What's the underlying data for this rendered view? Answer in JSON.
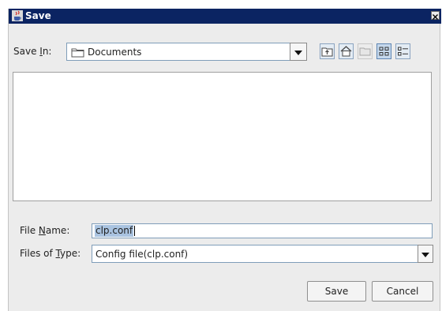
{
  "window": {
    "title": "Save",
    "title_icon": "java-coffee-cup-icon",
    "close_icon": "close-x-icon"
  },
  "save_in": {
    "label_before": "Save ",
    "label_mnemonic": "I",
    "label_after": "n:",
    "value": "Documents",
    "icon": "folder-icon"
  },
  "toolbar": {
    "buttons": [
      "up-one-level-icon",
      "home-icon",
      "new-folder-icon",
      "list-view-icon",
      "details-view-icon"
    ]
  },
  "file_name": {
    "label_before": "File ",
    "label_mnemonic": "N",
    "label_after": "ame:",
    "value": "clp.conf"
  },
  "file_type": {
    "label_before": "Files of ",
    "label_mnemonic": "T",
    "label_after": "ype:",
    "value": "Config file(clp.conf)"
  },
  "actions": {
    "save_label": "Save",
    "cancel_label": "Cancel"
  },
  "colors": {
    "titlebar": "#0b2462",
    "dialog_bg": "#ececec",
    "selection": "#a9c3e0"
  }
}
